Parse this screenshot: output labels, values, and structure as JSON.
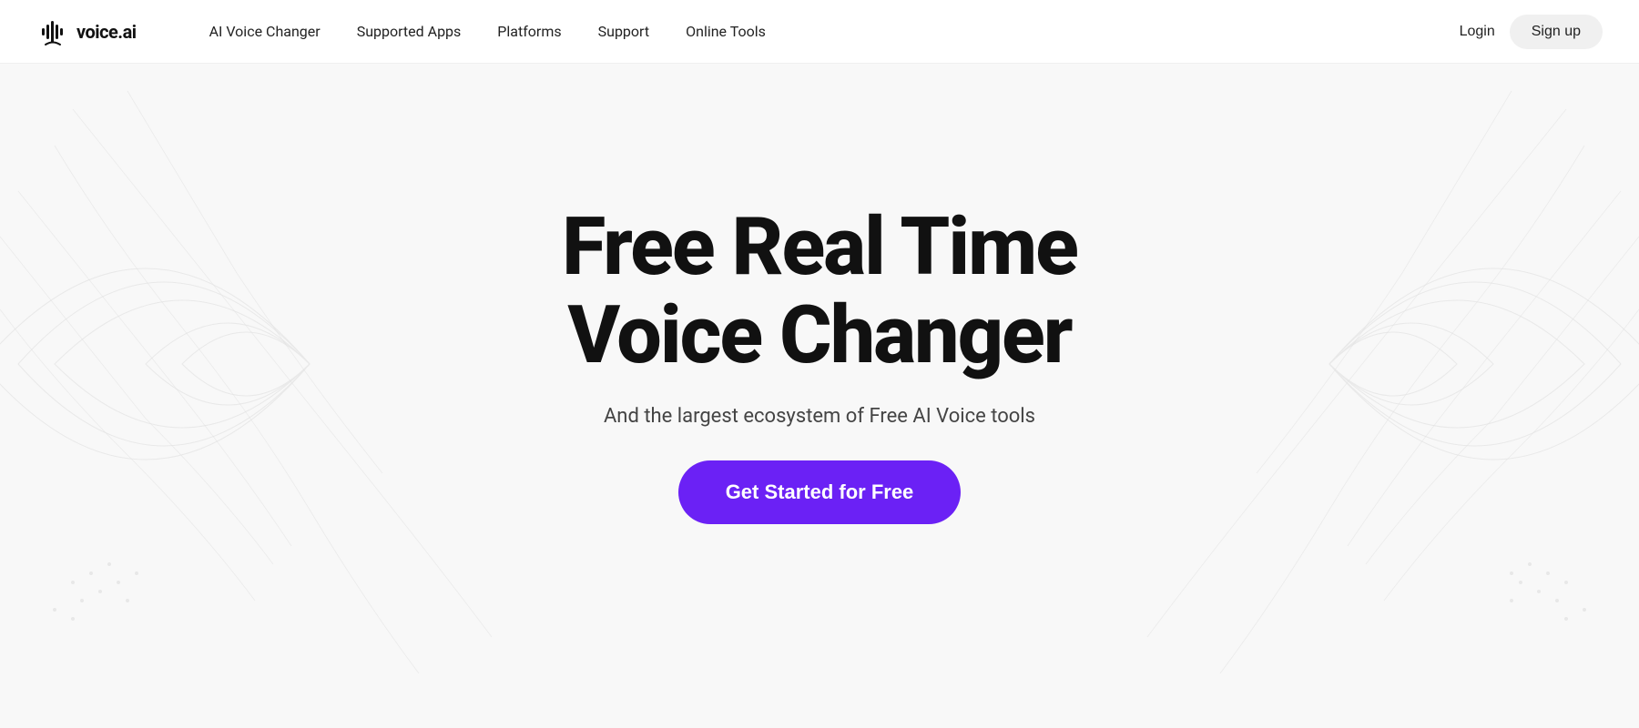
{
  "nav": {
    "logo_text": "voice.ai",
    "links": [
      {
        "label": "AI Voice Changer",
        "id": "ai-voice-changer"
      },
      {
        "label": "Supported Apps",
        "id": "supported-apps"
      },
      {
        "label": "Platforms",
        "id": "platforms"
      },
      {
        "label": "Support",
        "id": "support"
      },
      {
        "label": "Online Tools",
        "id": "online-tools"
      }
    ],
    "login_label": "Login",
    "signup_label": "Sign up"
  },
  "hero": {
    "title_line1": "Free Real Time",
    "title_line2": "Voice Changer",
    "subtitle": "And the largest ecosystem of Free AI Voice tools",
    "cta_label": "Get Started for Free"
  },
  "colors": {
    "cta_bg": "#6B21F5",
    "cta_text": "#ffffff",
    "title_color": "#111111",
    "nav_bg": "#ffffff"
  }
}
